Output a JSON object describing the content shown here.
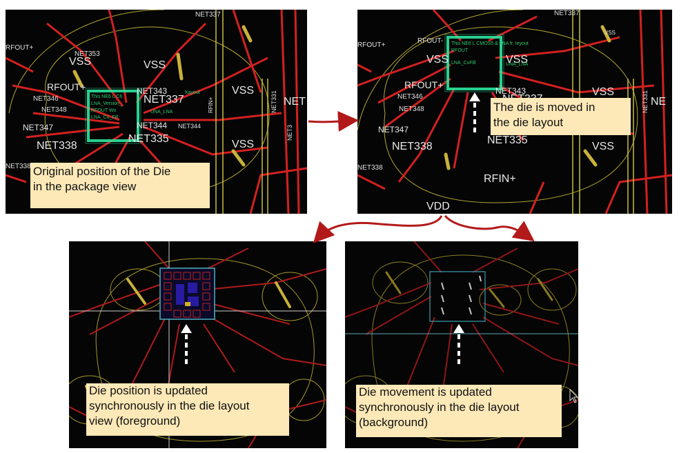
{
  "colors": {
    "trace_red": "#d42020",
    "ring_yellow": "#b8a830",
    "die_glow": "#2ee6a0",
    "caption_bg": "#fde9b8",
    "flow_arrow": "#b21a1a"
  },
  "panel_tl": {
    "nets": [
      "NET337",
      "RFOUT+",
      "NET353",
      "VSS",
      "RFOUT+",
      "VSS",
      "NET343",
      "NET337",
      "VSS",
      "NET346",
      "NET348",
      "NET344",
      "NET344",
      "NET347",
      "NET335",
      "NET338",
      "VSS",
      "NET331",
      "NET",
      "RFIN+",
      "NET338",
      "NET3"
    ],
    "die_text": [
      "This NE6 L C6",
      "LNA_Version_",
      "RFOUT Wo",
      "LNA_Cu_Fill",
      "Kayout",
      "UNA_LNA"
    ],
    "caption": [
      "Original position of the Die",
      "in the package view"
    ]
  },
  "panel_tr": {
    "nets": [
      "NET337",
      "VSS",
      "RFOUT+",
      "RFOUT-",
      "VSS",
      "VSS",
      "RFOUT+",
      "NET343",
      "NET337",
      "NET346",
      "NET348",
      "VSS",
      "NET347",
      "NET338",
      "NET335",
      "VSS",
      "NET338",
      "RFIN+",
      "VDD",
      "NET331",
      "NE"
    ],
    "die_text": [
      "This NE6 L CMOS5 & LNA fr. Ieyout",
      "RFOUT",
      "LNA_CuFill",
      "UNA_LNA"
    ],
    "caption": [
      "The die is moved in",
      "the die layout"
    ]
  },
  "panel_bl": {
    "caption": [
      "Die position is updated",
      "synchronously in the die layout",
      "view (foreground)"
    ]
  },
  "panel_br": {
    "caption": [
      "Die movement is updated",
      "synchronously in the die layout",
      "(background)"
    ]
  },
  "icons": {
    "move_up_arrow": "dashed-up-arrow-icon",
    "flow_arrow": "curved-red-arrow-icon",
    "cursor": "mouse-pointer-icon"
  }
}
